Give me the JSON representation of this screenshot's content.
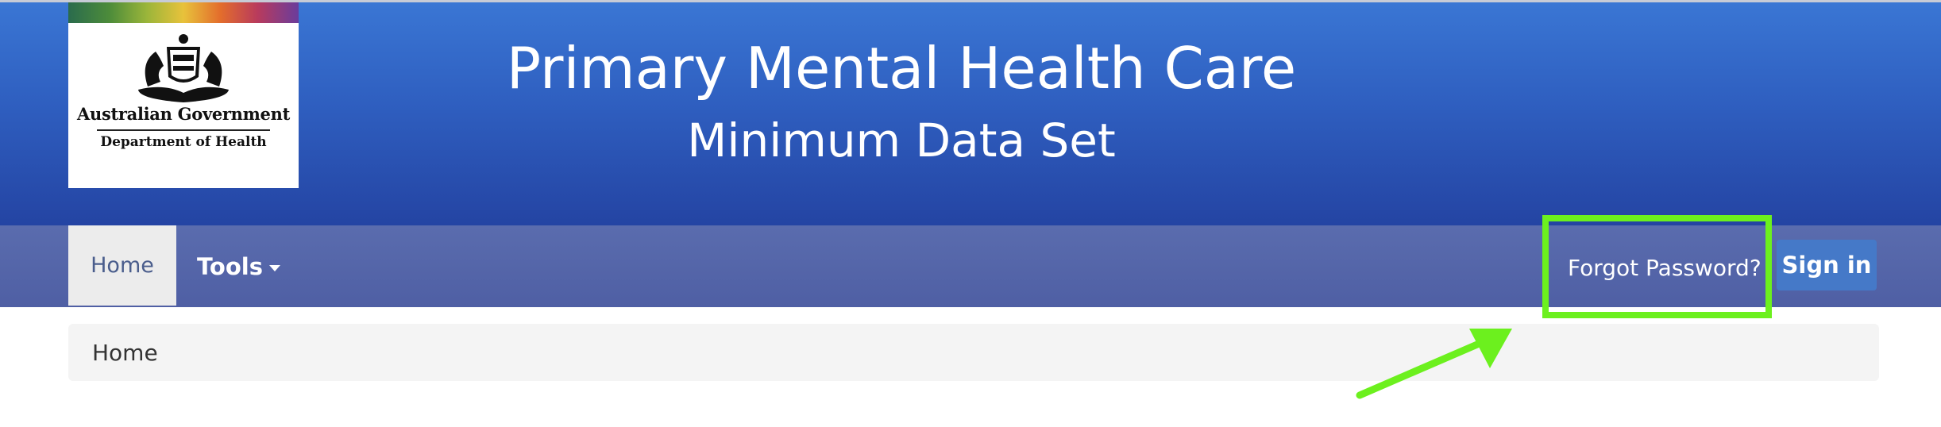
{
  "header": {
    "logo": {
      "text_line1": "Australian Government",
      "text_line2": "Department of Health"
    },
    "title": "Primary Mental Health Care",
    "subtitle": "Minimum Data Set"
  },
  "nav": {
    "home_label": "Home",
    "tools_label": "Tools",
    "forgot_password_label": "Forgot Password?",
    "sign_in_label": "Sign in"
  },
  "breadcrumb": {
    "items": [
      "Home"
    ]
  },
  "colors": {
    "banner": "#2f5fc0",
    "navbar": "#5466a8",
    "signin_button": "#4579c8",
    "highlight": "#6cf01e"
  },
  "icons": {
    "tools_caret": "caret-down-icon",
    "annotation": "arrow-icon"
  }
}
